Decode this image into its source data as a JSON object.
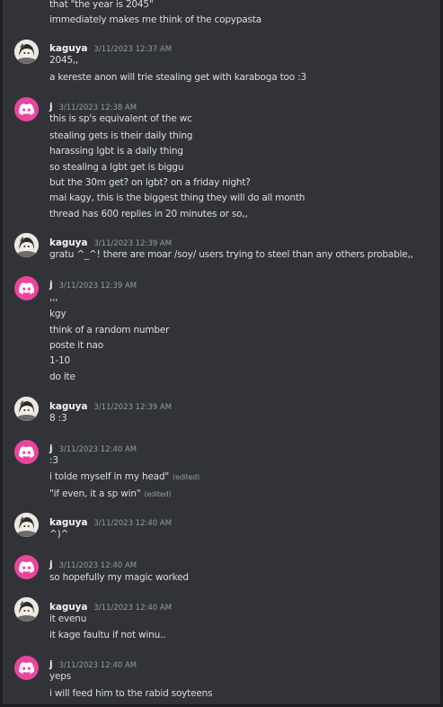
{
  "messages": [
    {
      "type": "cont",
      "lines": [
        {
          "text": "that \"the year is 2045\""
        },
        {
          "text": "immediately makes me think of the copypasta"
        }
      ]
    },
    {
      "type": "group",
      "author": "kaguya",
      "timestamp": "3/11/2023 12:37 AM",
      "lines": [
        {
          "text": "2045,,"
        },
        {
          "text": "a kereste anon will trie stealing get with karaboga too :3"
        }
      ]
    },
    {
      "type": "group",
      "author": "j",
      "timestamp": "3/11/2023 12:38 AM",
      "lines": [
        {
          "text": "this is sp's equivalent of the wc"
        },
        {
          "text": "stealing gets is their daily thing"
        },
        {
          "text": "harassing lgbt is a daily thing"
        },
        {
          "text": "so stealing a lgbt get is biggu"
        },
        {
          "text": "but the 30m get? on lgbt? on a friday night?"
        },
        {
          "text": "mai kagy, this is the biggest thing they will do all month"
        },
        {
          "text": "thread has 600 replies in 20 minutes or so,,"
        }
      ]
    },
    {
      "type": "group",
      "author": "kaguya",
      "timestamp": "3/11/2023 12:39 AM",
      "lines": [
        {
          "text": "gratu ^_^! there are moar /soy/ users trying to steel than any others probable,,"
        }
      ]
    },
    {
      "type": "group",
      "author": "j",
      "timestamp": "3/11/2023 12:39 AM",
      "lines": [
        {
          "text": ",,,"
        },
        {
          "text": "kgy"
        },
        {
          "text": "think of a random number"
        },
        {
          "text": "poste it nao"
        },
        {
          "text": "1-10"
        },
        {
          "text": "do ite"
        }
      ]
    },
    {
      "type": "group",
      "author": "kaguya",
      "timestamp": "3/11/2023 12:39 AM",
      "lines": [
        {
          "text": "8 :3"
        }
      ]
    },
    {
      "type": "group",
      "author": "j",
      "timestamp": "3/11/2023 12:40 AM",
      "lines": [
        {
          "text": ":3"
        },
        {
          "text": "i tolde myself in my head\"",
          "edited": "(edited)"
        },
        {
          "text": "\"if even, it a sp win\"",
          "edited": "(edited)"
        }
      ]
    },
    {
      "type": "group",
      "author": "kaguya",
      "timestamp": "3/11/2023 12:40 AM",
      "lines": [
        {
          "text": "^)^"
        }
      ]
    },
    {
      "type": "group",
      "author": "j",
      "timestamp": "3/11/2023 12:40 AM",
      "lines": [
        {
          "text": "so hopefully my magic worked"
        }
      ]
    },
    {
      "type": "group",
      "author": "kaguya",
      "timestamp": "3/11/2023 12:40 AM",
      "lines": [
        {
          "text": "it evenu"
        },
        {
          "text": "it kage faultu if not winu.."
        }
      ]
    },
    {
      "type": "group",
      "author": "j",
      "timestamp": "3/11/2023 12:40 AM",
      "lines": [
        {
          "text": "yeps"
        },
        {
          "text": "i will feed him to the rabid soyteens"
        }
      ]
    }
  ]
}
